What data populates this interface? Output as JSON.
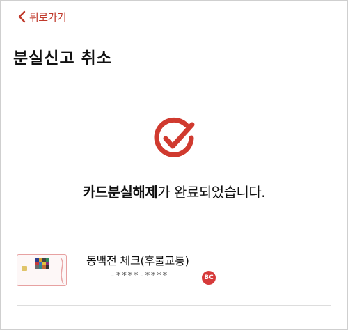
{
  "nav": {
    "back_label": "뒤로가기"
  },
  "page": {
    "title": "분실신고 취소"
  },
  "result": {
    "message_strong": "카드분실해제",
    "message_rest": "가 완료되었습니다."
  },
  "card": {
    "name": "동백전 체크(후불교통)",
    "number": "-****-****",
    "brand_logo_text": "BC"
  },
  "colors": {
    "accent": "#c0392b",
    "bc_brand": "#d63a3a"
  },
  "icons": {
    "back": "chevron-left-icon",
    "success": "check-circle-icon"
  }
}
